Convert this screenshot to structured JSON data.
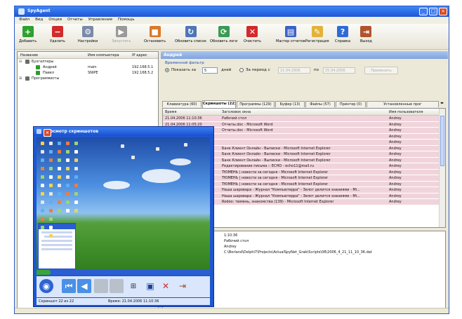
{
  "app": {
    "title": "SpyAgent"
  },
  "menu": [
    "Файл",
    "Вид",
    "Опции",
    "Отчеты",
    "Управление",
    "Помощь"
  ],
  "toolbar": [
    {
      "label": "Добавить",
      "icon": "add-icon",
      "color": "#2ea12e",
      "glyph": "+"
    },
    {
      "label": "Удалить",
      "icon": "remove-icon",
      "color": "#d12b2b",
      "glyph": "−"
    },
    {
      "label": "Настройки",
      "icon": "settings-icon",
      "color": "#7a8aa8",
      "glyph": "⚙"
    },
    {
      "label": "Запустить",
      "icon": "start-icon",
      "color": "#9a9a9a",
      "glyph": "▶",
      "disabled": true
    },
    {
      "label": "Остановить",
      "icon": "stop-icon",
      "color": "#d9792b",
      "glyph": "■"
    },
    {
      "label": "Обновить список",
      "icon": "refresh-list-icon",
      "color": "#4e76b8",
      "glyph": "↻"
    },
    {
      "label": "Обновить логи",
      "icon": "refresh-logs-icon",
      "color": "#3b9a55",
      "glyph": "⟳"
    },
    {
      "label": "Очистить",
      "icon": "clear-icon",
      "color": "#d12b2b",
      "glyph": "✕"
    },
    {
      "label": "Мастер отчетов",
      "icon": "report-wizard-icon",
      "color": "#3c62c8",
      "glyph": "▤"
    },
    {
      "label": "Регистрация",
      "icon": "register-icon",
      "color": "#e2b23a",
      "glyph": "✎"
    },
    {
      "label": "Справка",
      "icon": "help-icon",
      "color": "#2f6bd6",
      "glyph": "?"
    },
    {
      "label": "Выход",
      "icon": "exit-icon",
      "color": "#b2542b",
      "glyph": "⇥"
    }
  ],
  "tree": {
    "columns": [
      "Название",
      "Имя компьютера",
      "IP адрес"
    ],
    "rows": [
      {
        "label": "Бухгалтеры",
        "computer": "",
        "ip": "",
        "level": 0,
        "type": "group"
      },
      {
        "label": "Андрей",
        "computer": "main",
        "ip": "192.168.5.1",
        "level": 1,
        "type": "pc"
      },
      {
        "label": "Павел",
        "computer": "SNIPE",
        "ip": "192.168.5.2",
        "level": 1,
        "type": "pc"
      },
      {
        "label": "Программисты",
        "computer": "",
        "ip": "",
        "level": 0,
        "type": "group"
      }
    ]
  },
  "right": {
    "header": "Андрей",
    "filter": {
      "label": "Временной фильтр",
      "show_for": "Показать за",
      "days_value": "5",
      "days_label": "дней",
      "period_label": "За период с",
      "date_from": "21.04.2006",
      "date_to_label": "по",
      "date_to": "25.04.2006",
      "apply_label": "Применить"
    },
    "tabs": [
      "Клавиатура (60)",
      "Скриншоты (22)",
      "Программы (129)",
      "Буфер (13)",
      "Файлы (57)",
      "Принтер (0)",
      "Установленные прог"
    ],
    "active_tab": 1,
    "grid": {
      "columns": [
        "Время",
        "Заголовок окна",
        "Имя пользователя"
      ],
      "rows": [
        {
          "time": "21.04.2006 11:10:36",
          "title": "Рабочий стол",
          "user": "Andrey"
        },
        {
          "time": "21.04.2006 11:05:20",
          "title": "Отчеты.doc - Microsoft Word",
          "user": "Andrey"
        },
        {
          "time": "",
          "title": "Отчеты.doc - Microsoft Word",
          "user": "Andrey"
        },
        {
          "time": "",
          "title": "",
          "user": "Andrey"
        },
        {
          "time": "",
          "title": "",
          "user": "Andrey"
        },
        {
          "time": "",
          "title": "Банк Клиент Онлайн - Выписки - Microsoft Internet Explorer",
          "user": "Andrey"
        },
        {
          "time": "",
          "title": "Банк Клиент Онлайн - Выписки - Microsoft Internet Explorer",
          "user": "Andrey"
        },
        {
          "time": "",
          "title": "Банк Клиент Онлайн - Выписки - Microsoft Internet Explorer",
          "user": "Andrey"
        },
        {
          "time": "",
          "title": "Редактирование письма :: ECHO - echo11@mail.ru",
          "user": "Andrey"
        },
        {
          "time": "",
          "title": "ТЮМЕНЬ | новости за сегодня - Microsoft Internet Explorer",
          "user": "Andrey"
        },
        {
          "time": "",
          "title": "ТЮМЕНЬ | новости за сегодня - Microsoft Internet Explorer",
          "user": "Andrey"
        },
        {
          "time": "",
          "title": "ТЮМЕНЬ | новости за сегодня - Microsoft Internet Explorer",
          "user": "Andrey"
        },
        {
          "time": "",
          "title": "Наша шаровара - Журнал \"Компьютерра\" - Зелот делится знаниями - Mi...",
          "user": "Andrey"
        },
        {
          "time": "",
          "title": "Наша шаровара - Журнал \"Компьютерра\" - Зелот делится знаниями - Mi...",
          "user": "Andrey"
        },
        {
          "time": "",
          "title": "Rodeo: тюмень, знакомства (139) - Microsoft Internet Explorer",
          "user": "Andrey"
        }
      ]
    },
    "detail": {
      "time": "1:10:36",
      "window": "Рабочий стол",
      "user": "Andrey",
      "path": "C:\\Borland\\Delphi7\\Projects\\ActualSpyNet_Grab\\Scripts\\08\\2006_4_21_11_10_36.dat"
    }
  },
  "viewer": {
    "title": "Просмотр скриншотов",
    "status_left": "Скриншот 22 из 22",
    "status_right": "Время: 21.04.2006 11:10:36"
  }
}
